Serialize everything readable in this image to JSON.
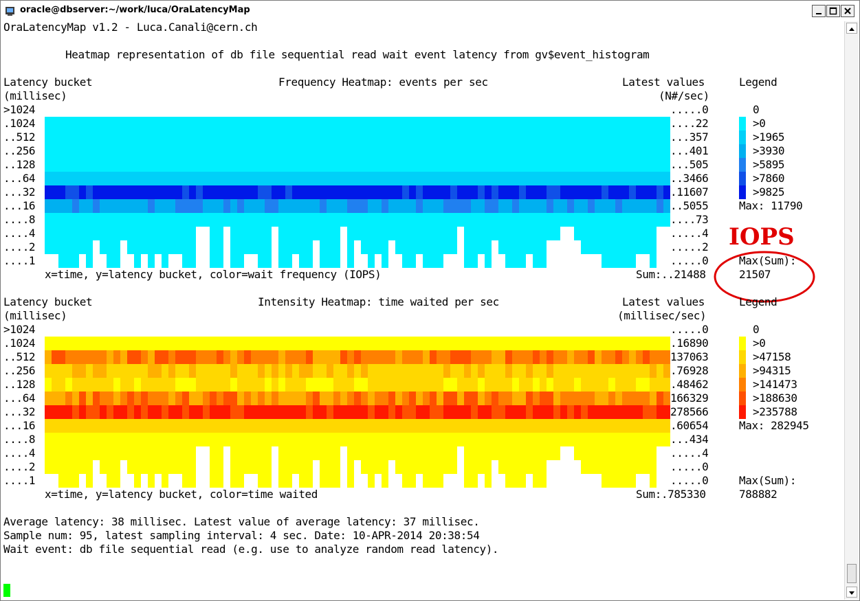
{
  "window": {
    "title": "oracle@dbserver:~/work/luca/OraLatencyMap"
  },
  "header": {
    "app": "OraLatencyMap v1.2 - Luca.Canali@cern.ch",
    "description": "Heatmap representation of db file sequential read wait event latency from gv$event_histogram"
  },
  "buckets": [
    ">1024",
    ".1024",
    "..512",
    "..256",
    "..128",
    "...64",
    "...32",
    "...16",
    "....8",
    "....4",
    "....2",
    "....1"
  ],
  "frequency": {
    "col_label_1": "Latency bucket",
    "col_label_2": "(millisec)",
    "title": "Frequency Heatmap: events per sec",
    "latest_label": "Latest values",
    "latest_unit": "(N#/sec)",
    "latest_values": [
      ".....0",
      "....22",
      "...357",
      "...401",
      "...505",
      "..3466",
      ".11607",
      "..5055",
      "....73",
      ".....4",
      ".....2",
      ".....0"
    ],
    "legend_title": "Legend",
    "legend": [
      {
        "label": "0",
        "color": "#ffffff"
      },
      {
        "label": ">0",
        "color": "#00f0ff"
      },
      {
        "label": ">1965",
        "color": "#00d0f8"
      },
      {
        "label": ">3930",
        "color": "#00b0f0"
      },
      {
        "label": ">5895",
        "color": "#2080f0"
      },
      {
        "label": ">7860",
        "color": "#1050e8"
      },
      {
        "label": ">9825",
        "color": "#0018e8"
      }
    ],
    "max": "Max: 11790",
    "axis_caption": "x=time, y=latency bucket, color=wait frequency (IOPS)",
    "sum": "Sum:..21488",
    "max_sum_label": "Max(Sum):",
    "max_sum_value": "21507",
    "annotation": "IOPS"
  },
  "intensity": {
    "col_label_1": "Latency bucket",
    "col_label_2": "(millisec)",
    "title": "Intensity Heatmap: time waited per sec",
    "latest_label": "Latest values",
    "latest_unit": "(millisec/sec)",
    "latest_values": [
      ".....0",
      ".16890",
      "137063",
      ".76928",
      ".48462",
      "166329",
      "278566",
      ".60654",
      "...434",
      ".....4",
      ".....0",
      ".....0"
    ],
    "legend_title": "Legend",
    "legend": [
      {
        "label": "0",
        "color": "#ffffff"
      },
      {
        "label": ">0",
        "color": "#ffff00"
      },
      {
        "label": ">47158",
        "color": "#ffd800"
      },
      {
        "label": ">94315",
        "color": "#ffb000"
      },
      {
        "label": ">141473",
        "color": "#ff8000"
      },
      {
        "label": ">188630",
        "color": "#ff5000"
      },
      {
        "label": ">235788",
        "color": "#ff1800"
      }
    ],
    "max": "Max: 282945",
    "axis_caption": "x=time, y=latency bucket, color=time waited",
    "sum": "Sum:.785330",
    "max_sum_label": "Max(Sum):",
    "max_sum_value": "788882"
  },
  "footer": {
    "line1": "Average latency: 38 millisec. Latest value of average latency: 37 millisec.",
    "line2": "Sample num: 95, latest sampling interval: 4 sec. Date: 10-APR-2014 20:38:54",
    "line3": "Wait event: db file sequential read (e.g. use to analyze random read latency)."
  }
}
